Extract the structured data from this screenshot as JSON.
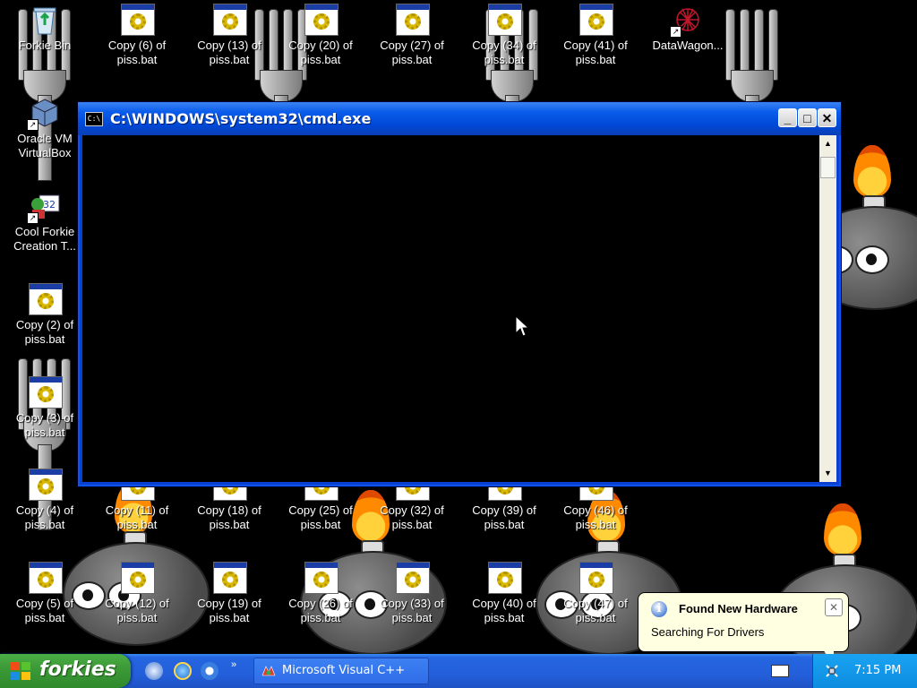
{
  "desktop": {
    "icons_col0": [
      {
        "label": "Forkie Bin",
        "icon": "recycle-bin-icon"
      },
      {
        "label": "Oracle VM VirtualBox",
        "icon": "virtualbox-icon"
      },
      {
        "label": "Cool Forkie Creation T...",
        "icon": "forkie-creation-icon"
      },
      {
        "label": "Copy (2) of piss.bat",
        "icon": "batch-file-icon"
      },
      {
        "label": "Copy (3) of piss.bat",
        "icon": "batch-file-icon"
      },
      {
        "label": "Copy (4) of piss.bat",
        "icon": "batch-file-icon"
      },
      {
        "label": "Copy (5) of piss.bat",
        "icon": "batch-file-icon"
      }
    ],
    "icons_top_row": [
      {
        "label": "Copy (6) of piss.bat"
      },
      {
        "label": "Copy (13) of piss.bat"
      },
      {
        "label": "Copy (20) of piss.bat"
      },
      {
        "label": "Copy (27) of piss.bat"
      },
      {
        "label": "Copy (34) of piss.bat"
      },
      {
        "label": "Copy (41) of piss.bat"
      },
      {
        "label": "DataWagon...",
        "icon": "datawagon-icon"
      }
    ],
    "icons_row_mid": [
      {
        "label": "Copy (11) of piss.bat"
      },
      {
        "label": "Copy (18) of piss.bat"
      },
      {
        "label": "Copy (25) of piss.bat"
      },
      {
        "label": "Copy (32) of piss.bat"
      },
      {
        "label": "Copy (39) of piss.bat"
      },
      {
        "label": "Copy (46) of piss.bat"
      }
    ],
    "icons_row_bottom": [
      {
        "label": "Copy (12) of piss.bat"
      },
      {
        "label": "Copy (19) of piss.bat"
      },
      {
        "label": "Copy (26) of piss.bat"
      },
      {
        "label": "Copy (33) of piss.bat"
      },
      {
        "label": "Copy (40) of piss.bat"
      },
      {
        "label": "Copy (47) of piss.bat"
      }
    ]
  },
  "cmd_window": {
    "title": "C:\\WINDOWS\\system32\\cmd.exe",
    "app_icon_text": "C:\\",
    "minimize_symbol": "_",
    "maximize_symbol": "□",
    "close_symbol": "✕",
    "scroll_up_symbol": "▲",
    "scroll_down_symbol": "▼"
  },
  "notification": {
    "title": "Found New Hardware",
    "message": "Searching For Drivers",
    "icon": "info-icon",
    "close_symbol": "✕"
  },
  "taskbar": {
    "start_label": "forkies",
    "overflow_symbol": "»",
    "task_label": "Microsoft Visual C++",
    "clock": "7:15 PM"
  },
  "colors": {
    "titlebar_blue": "#0a5cea",
    "taskbar_blue": "#245fdb",
    "start_green": "#3c9a37",
    "tray_blue": "#0d8de0",
    "balloon_yellow": "#ffffe1"
  }
}
